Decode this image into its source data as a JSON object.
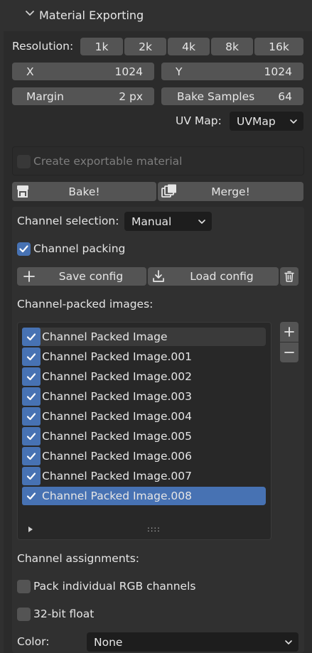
{
  "panel": {
    "title": "Material Exporting"
  },
  "resolution": {
    "label": "Resolution:",
    "options": [
      "1k",
      "2k",
      "4k",
      "8k",
      "16k"
    ]
  },
  "size": {
    "x_label": "X",
    "x_value": "1024",
    "y_label": "Y",
    "y_value": "1024"
  },
  "margin": {
    "label": "Margin",
    "value": "2 px"
  },
  "bake_samples": {
    "label": "Bake Samples",
    "value": "64"
  },
  "uv_map": {
    "label": "UV Map:",
    "value": "UVMap"
  },
  "create_material": {
    "label": "Create exportable material",
    "checked": false,
    "enabled": false
  },
  "actions": {
    "bake_label": "Bake!",
    "merge_label": "Merge!"
  },
  "channel_selection": {
    "label": "Channel selection:",
    "value": "Manual"
  },
  "channel_packing": {
    "label": "Channel packing",
    "checked": true
  },
  "config": {
    "save_label": "Save config",
    "load_label": "Load config"
  },
  "packed_images": {
    "label": "Channel-packed images:",
    "items": [
      {
        "name": "Channel Packed Image",
        "checked": true
      },
      {
        "name": "Channel Packed Image.001",
        "checked": true
      },
      {
        "name": "Channel Packed Image.002",
        "checked": true
      },
      {
        "name": "Channel Packed Image.003",
        "checked": true
      },
      {
        "name": "Channel Packed Image.004",
        "checked": true
      },
      {
        "name": "Channel Packed Image.005",
        "checked": true
      },
      {
        "name": "Channel Packed Image.006",
        "checked": true
      },
      {
        "name": "Channel Packed Image.007",
        "checked": true
      },
      {
        "name": "Channel Packed Image.008",
        "checked": true
      }
    ],
    "selected_index": 8,
    "hovered_index": 0,
    "resize_grip": "::::"
  },
  "channel_assignments": {
    "label": "Channel assignments:"
  },
  "pack_rgb": {
    "label": "Pack individual RGB channels",
    "checked": false
  },
  "float32": {
    "label": "32-bit float",
    "checked": false
  },
  "color": {
    "label": "Color:",
    "value": "None"
  },
  "colors": {
    "accent": "#4772b3",
    "button": "#545454",
    "panel": "#2b2b2b",
    "field_dark": "#1d1d1d"
  },
  "icons": [
    "chevron-down-icon",
    "bake-icon",
    "merge-icon",
    "plus-icon",
    "download-icon",
    "trash-icon",
    "minus-icon",
    "checkmark-icon",
    "expand-triangle-icon"
  ]
}
